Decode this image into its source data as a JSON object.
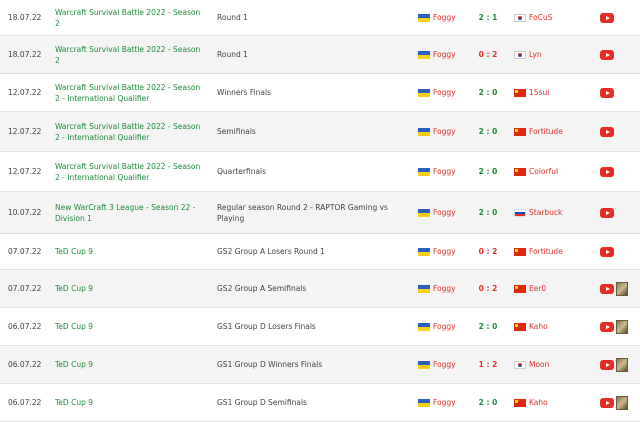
{
  "matches": [
    {
      "date": "18.07.22",
      "tournament": "Warcraft Survival Battle 2022 - Season 2",
      "round": "Round 1",
      "player1": "Foggy",
      "flag1": "ua",
      "score": "2 : 1",
      "result": "win",
      "player2": "FoCuS",
      "flag2": "kr",
      "thumb": false
    },
    {
      "date": "18.07.22",
      "tournament": "Warcraft Survival Battle 2022 - Season 2",
      "round": "Round 1",
      "player1": "Foggy",
      "flag1": "ua",
      "score": "0 : 2",
      "result": "loss",
      "player2": "Lyn",
      "flag2": "kr",
      "thumb": false
    },
    {
      "date": "12.07.22",
      "tournament": "Warcraft Survival Battle 2022 - Season 2 - International Qualifier",
      "round": "Winners Finals",
      "player1": "Foggy",
      "flag1": "ua",
      "score": "2 : 0",
      "result": "win",
      "player2": "15sui",
      "flag2": "cn",
      "thumb": false
    },
    {
      "date": "12.07.22",
      "tournament": "Warcraft Survival Battle 2022 - Season 2 - International Qualifier",
      "round": "Semifinals",
      "player1": "Foggy",
      "flag1": "ua",
      "score": "2 : 0",
      "result": "win",
      "player2": "Fortitude",
      "flag2": "cn",
      "thumb": false
    },
    {
      "date": "12.07.22",
      "tournament": "Warcraft Survival Battle 2022 - Season 2 - International Qualifier",
      "round": "Quarterfinals",
      "player1": "Foggy",
      "flag1": "ua",
      "score": "2 : 0",
      "result": "win",
      "player2": "Colorful",
      "flag2": "cn",
      "thumb": false
    },
    {
      "date": "10.07.22",
      "tournament": "New WarCraft 3 League - Season 22 - Division 1",
      "round": "Regular season Round 2 - RAPTOR Gaming vs Playing",
      "player1": "Foggy",
      "flag1": "ua",
      "score": "2 : 0",
      "result": "win",
      "player2": "Starbuck",
      "flag2": "si",
      "thumb": false
    },
    {
      "date": "07.07.22",
      "tournament": "TeD Cup 9",
      "round": "GS2 Group A Losers Round 1",
      "player1": "Foggy",
      "flag1": "ua",
      "score": "0 : 2",
      "result": "loss",
      "player2": "Fortitude",
      "flag2": "cn",
      "thumb": false
    },
    {
      "date": "07.07.22",
      "tournament": "TeD Cup 9",
      "round": "GS2 Group A Semifinals",
      "player1": "Foggy",
      "flag1": "ua",
      "score": "0 : 2",
      "result": "loss",
      "player2": "Eer0",
      "flag2": "cn",
      "thumb": true
    },
    {
      "date": "06.07.22",
      "tournament": "TeD Cup 9",
      "round": "GS1 Group D Losers Finals",
      "player1": "Foggy",
      "flag1": "ua",
      "score": "2 : 0",
      "result": "win",
      "player2": "Kaho",
      "flag2": "cn",
      "thumb": true
    },
    {
      "date": "06.07.22",
      "tournament": "TeD Cup 9",
      "round": "GS1 Group D Winners Finals",
      "player1": "Foggy",
      "flag1": "ua",
      "score": "1 : 2",
      "result": "loss",
      "player2": "Moon",
      "flag2": "kr",
      "thumb": true
    },
    {
      "date": "06.07.22",
      "tournament": "TeD Cup 9",
      "round": "GS1 Group D Semifinals",
      "player1": "Foggy",
      "flag1": "ua",
      "score": "2 : 0",
      "result": "win",
      "player2": "Kaho",
      "flag2": "cn",
      "thumb": true
    }
  ]
}
